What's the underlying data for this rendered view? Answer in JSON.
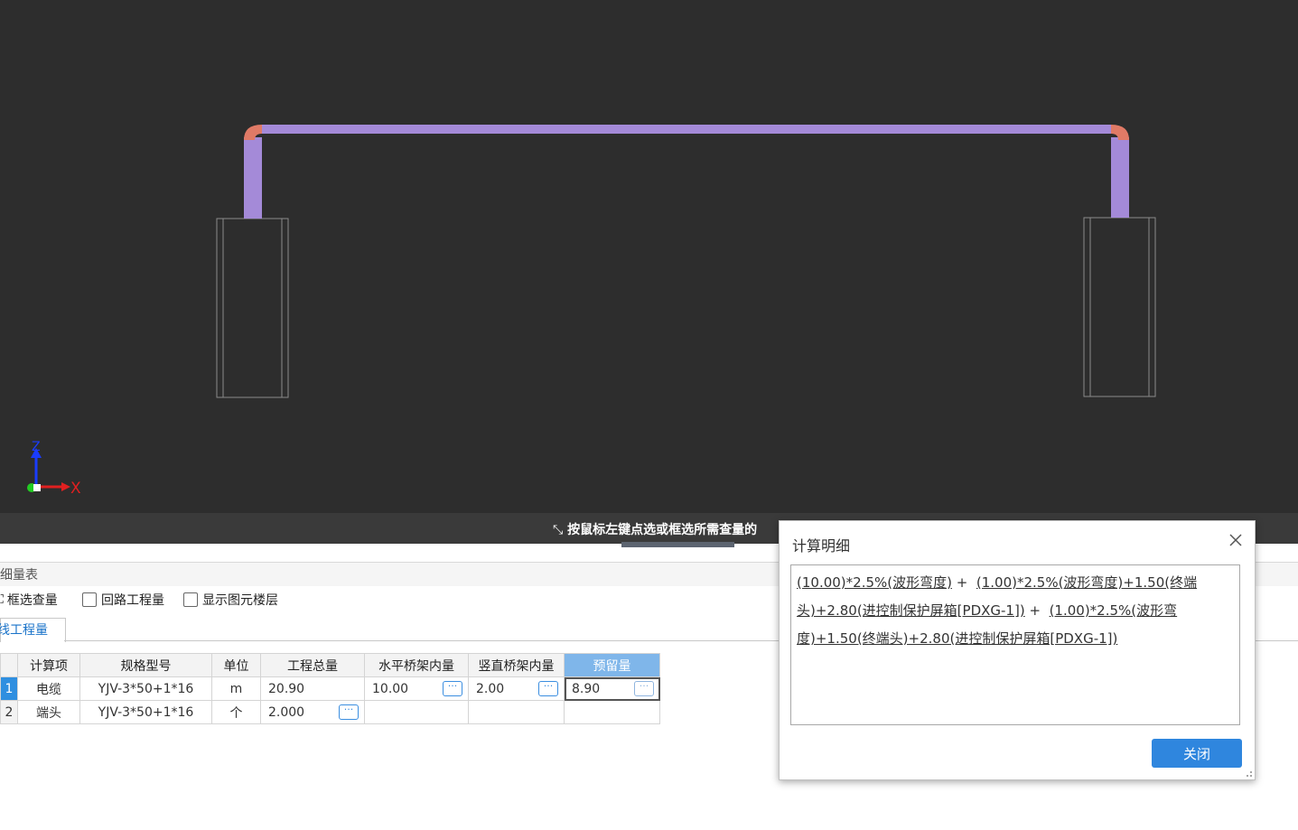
{
  "viewport": {
    "axis_labels": {
      "z": "Z",
      "x": "X"
    },
    "colors": {
      "background": "#2d2d2d",
      "pipe": "#a48ad8",
      "pipe_bend": "#e07a66",
      "box_outline": "#8a8a8a"
    }
  },
  "status": {
    "text": "按鼠标左键点选或框选所需查量的"
  },
  "panel": {
    "title": "明细量表",
    "toolbar": {
      "box_select": "框选查量",
      "loop_quantity": "回路工程量",
      "show_floor": "显示图元楼层"
    },
    "tab": "线工程量",
    "table": {
      "columns": [
        "计算项",
        "规格型号",
        "单位",
        "工程总量",
        "水平桥架内量",
        "竖直桥架内量",
        "预留量"
      ],
      "rows": [
        {
          "no": "1",
          "item": "电缆",
          "spec": "YJV-3*50+1*16",
          "unit": "m",
          "total": "20.90",
          "horiz": "10.00",
          "vert": "2.00",
          "reserve": "8.90"
        },
        {
          "no": "2",
          "item": "端头",
          "spec": "YJV-3*50+1*16",
          "unit": "个",
          "total": "2.000",
          "horiz": "",
          "vert": "",
          "reserve": ""
        }
      ]
    }
  },
  "dialog": {
    "title": "计算明细",
    "formula_parts": [
      "(10.00)*2.5%(波形弯度)",
      " + ",
      "(1.00)*2.5%(波形弯度)+1.50(终端头)+2.80(进控制保护屏箱[PDXG-1])",
      " + ",
      "(1.00)*2.5%(波形弯度)+1.50(终端头)+2.80(进控制保护屏箱[PDXG-1])"
    ],
    "close_button": "关闭"
  }
}
